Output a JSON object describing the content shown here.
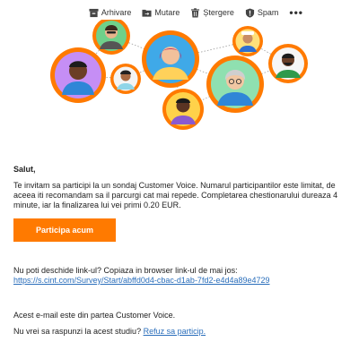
{
  "toolbar": {
    "archive_label": "Arhivare",
    "move_label": "Mutare",
    "delete_label": "Ștergere",
    "spam_label": "Spam",
    "more_label": "•••"
  },
  "email": {
    "greeting": "Salut,",
    "intro": "Te invitam sa participi la un sondaj Customer Voice. Numarul participantilor este limitat, de aceea iti recomandam sa il parcurgi cat mai repede. Completarea chestionarului dureaza 4 minute, iar la finalizarea lui vei primi 0.20 EUR.",
    "cta_label": "Participa acum",
    "link_prompt": "Nu poti deschide link-ul? Copiaza in browser link-ul de mai jos: ",
    "survey_url": "https://s.cint.com/Survey/Start/abffd0d4-cbac-d1ab-7fd2-e4d4a89e4729",
    "source_note": "Acest e-mail este din partea Customer Voice.",
    "optout_prompt": "Nu vrei sa raspunzi la acest studiu? ",
    "optout_link": "Refuz sa particip."
  },
  "colors": {
    "accent": "#ff7a00",
    "link": "#2a6ebb"
  }
}
